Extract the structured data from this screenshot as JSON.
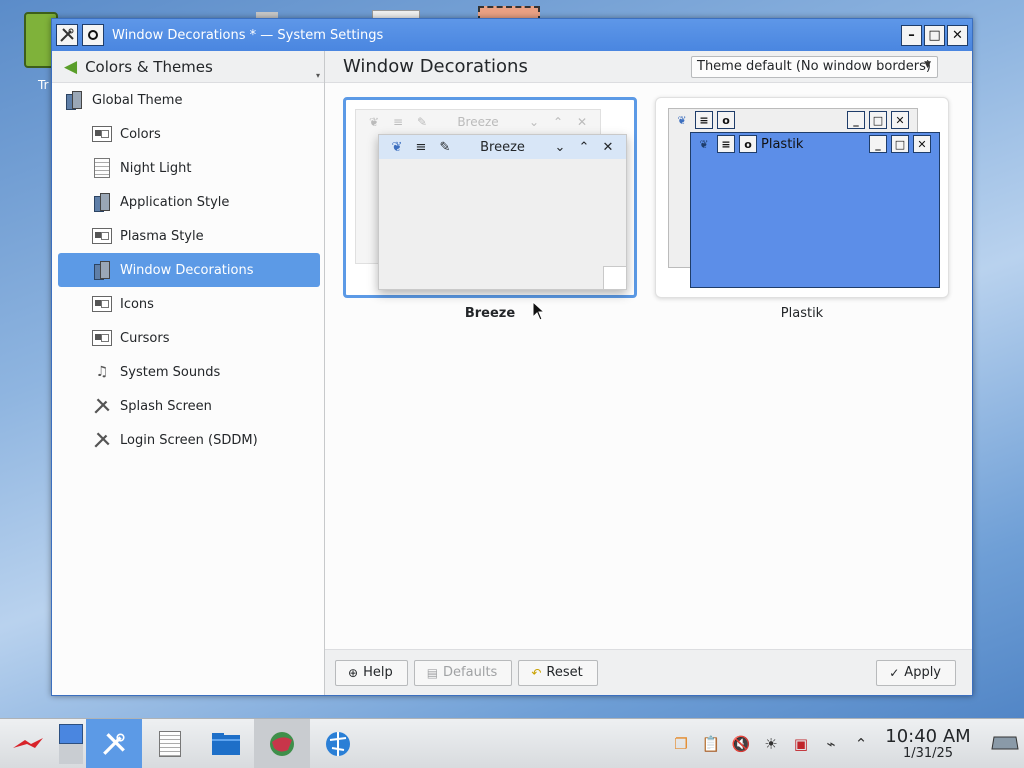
{
  "desktop": {
    "trash_label": "Tr"
  },
  "window": {
    "title": "Window Decorations * — System Settings",
    "buttons": {
      "minimize": "–",
      "maximize": "□",
      "close": "✕"
    }
  },
  "sidebar": {
    "header": "Colors & Themes",
    "top_item": {
      "label": "Global Theme",
      "icon": "global-theme-icon"
    },
    "items": [
      {
        "label": "Colors",
        "icon": "colors-icon"
      },
      {
        "label": "Night Light",
        "icon": "night-light-icon"
      },
      {
        "label": "Application Style",
        "icon": "application-style-icon"
      },
      {
        "label": "Plasma Style",
        "icon": "plasma-style-icon"
      },
      {
        "label": "Window Decorations",
        "icon": "window-decorations-icon",
        "selected": true
      },
      {
        "label": "Icons",
        "icon": "icons-icon"
      },
      {
        "label": "Cursors",
        "icon": "cursors-icon"
      },
      {
        "label": "System Sounds",
        "icon": "system-sounds-icon"
      },
      {
        "label": "Splash Screen",
        "icon": "splash-screen-icon"
      },
      {
        "label": "Login Screen (SDDM)",
        "icon": "login-screen-icon"
      }
    ]
  },
  "main": {
    "title": "Window Decorations",
    "theme_select": "Theme default (No window borders)",
    "decorations": [
      {
        "name": "Breeze",
        "selected": true,
        "preview_title": "Breeze"
      },
      {
        "name": "Plastik",
        "selected": false,
        "preview_title": "Plastik"
      }
    ]
  },
  "buttons": {
    "help": "Help",
    "defaults": "Defaults",
    "reset": "Reset",
    "apply": "Apply"
  },
  "taskbar": {
    "time": "10:40 AM",
    "date": "1/31/25"
  },
  "colors": {
    "accent": "#5c9ae6",
    "titlebar": "#4a86e0",
    "plastik_blue": "#5c8ee8"
  }
}
